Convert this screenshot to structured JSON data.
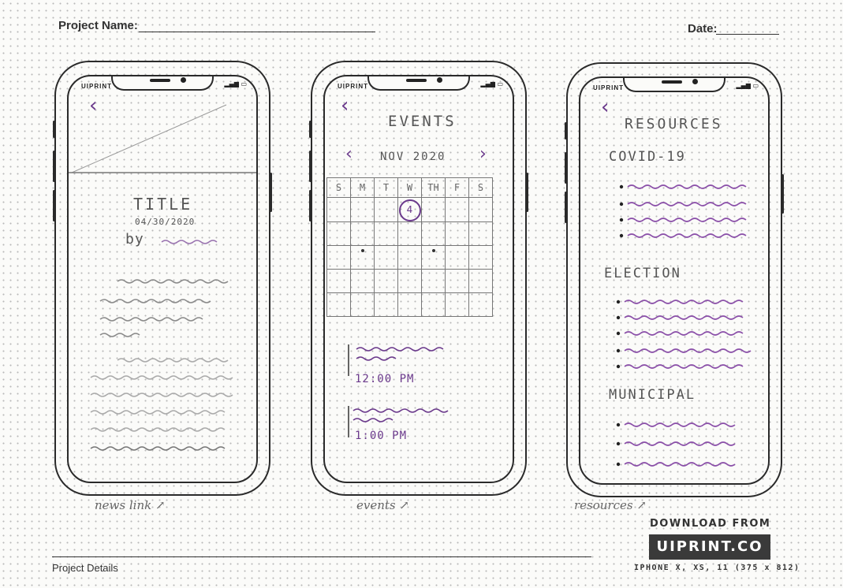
{
  "header": {
    "project_name_label": "Project Name:",
    "date_label": "Date:"
  },
  "phone_brand": "UIPRINT",
  "phones": {
    "news": {
      "article_title": "TITLE",
      "article_date": "04/30/2020",
      "byline": "by",
      "caption": "news link"
    },
    "events": {
      "heading": "EVENTS",
      "month": "NOV 2020",
      "weekdays": [
        "S",
        "M",
        "T",
        "W",
        "TH",
        "F",
        "S"
      ],
      "today": "4",
      "event_times": [
        "12:00 PM",
        "1:00 PM"
      ],
      "caption": "events"
    },
    "resources": {
      "heading": "RESOURCES",
      "sections": [
        "COVID-19",
        "ELECTION",
        "MUNICIPAL"
      ],
      "caption": "resources"
    }
  },
  "footer": {
    "project_details_label": "Project Details",
    "download_label": "DOWNLOAD FROM",
    "site": "UIPRINT.CO",
    "device_note": "IPHONE X, XS, 11 (375 x 812)"
  },
  "colors": {
    "accent": "#6b3a8c",
    "ink": "#2a2a2a"
  },
  "icons": {
    "back": "back-chevron-icon",
    "prev_month": "chevron-left-icon",
    "next_month": "chevron-right-icon",
    "signal": "signal-icon",
    "battery": "battery-icon"
  }
}
